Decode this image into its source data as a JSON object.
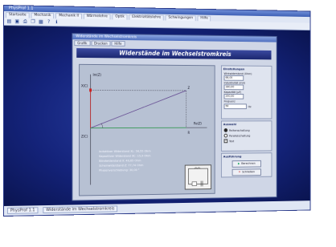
{
  "app": {
    "title": "PhysProf 1.1",
    "menu": [
      "Startseite",
      "Mechanik",
      "Mechanik II",
      "Wärmelehre",
      "Optik",
      "Elektrizitätslehre",
      "Schwingungen",
      "Hilfe"
    ],
    "toolbar_icons": [
      "open-icon",
      "save-icon",
      "print-icon",
      "copy-icon",
      "paste-icon",
      "help-icon",
      "info-icon"
    ],
    "status": [
      "PhysProf 1.1",
      "Widerstände im Wechselstromkreis"
    ]
  },
  "window": {
    "title": "Widerstände im Wechselstromkreis",
    "tabs": [
      "Grafik",
      "Drucken",
      "Hilfe"
    ],
    "heading": "Widerstände im Wechselstromkreis"
  },
  "plot": {
    "y_label_top": "Im(Z)",
    "y_label_mid": "X(C)",
    "y_label_z": "Z(C)",
    "x_label": "Re(Z)",
    "x_label_r": "R",
    "point_label": "Z",
    "results": [
      "Induktiver Widerstand XL: 56,55 Ohm",
      "Kapazitiver Widerstand XC: 15,9 Ohm",
      "Blindwiderstand X: 40,65 Ohm",
      "Scheinwiderstand Z: 77,74 Ohm",
      "Phasenverschiebung: 30,00 °"
    ]
  },
  "settings": {
    "title": "Einstellungen",
    "resistance_label": "Wirkwiderstand (Ohm)",
    "resistance_value": "66,00",
    "inductance_label": "Induktivität (mH)",
    "inductance_value": "180,00",
    "capacitance_label": "Kapazität (µF)",
    "capacitance_value": "200,00",
    "frequency_label": "Frequenz",
    "frequency_value": "50",
    "frequency_unit": "Hz"
  },
  "options": {
    "title": "Auswahl",
    "radio_series": "Reihenschaltung",
    "radio_parallel": "Parallelschaltung",
    "check_grid": "Text"
  },
  "actions": {
    "title": "Ausführung",
    "calculate": "Berechnen",
    "close": "Schließen"
  },
  "colors": {
    "heading_bg": "#1b2770",
    "desktop": "#14237a"
  }
}
